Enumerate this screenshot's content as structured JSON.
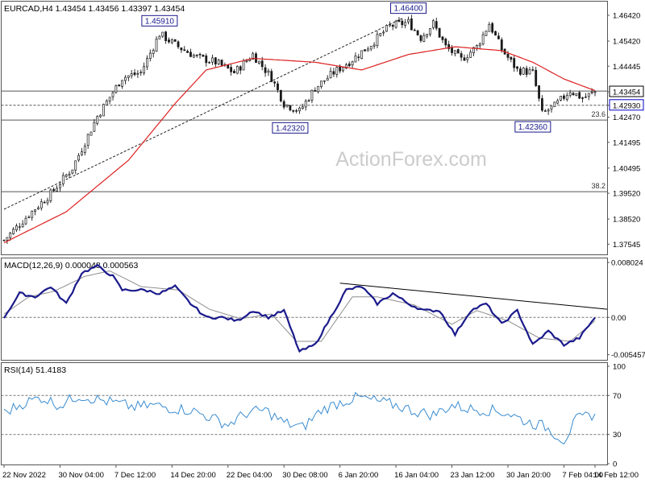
{
  "chart_data": [
    {
      "type": "candlestick",
      "panel": "price",
      "title": "EURCAD,H4  1.43454 1.43456 1.43397 1.43454",
      "watermark": "ActionForex.com",
      "ylim": [
        1.3715,
        1.4695
      ],
      "y_ticks": [
        "1.46420",
        "1.45420",
        "1.44445",
        "1.43454",
        "1.42930",
        "1.42470",
        "1.41495",
        "1.40495",
        "1.39520",
        "1.38520",
        "1.37545"
      ],
      "y_tick_values": [
        1.4642,
        1.4542,
        1.44445,
        1.43454,
        1.4293,
        1.4247,
        1.41495,
        1.40495,
        1.3952,
        1.3852,
        1.37545
      ],
      "last_price": "1.43454",
      "highlight_level": "1.42930",
      "fib_levels": [
        {
          "label": "23.6",
          "value": 1.4236
        },
        {
          "label": "38.2",
          "value": 1.3958
        }
      ],
      "horizontal_lines": [
        1.4348,
        1.4293,
        1.4236,
        1.3958
      ],
      "trend_line": [
        {
          "i": 0,
          "v": 1.389
        },
        {
          "i": 128,
          "v": 1.463
        }
      ],
      "annotations": [
        {
          "text": "1.45910",
          "i": 50,
          "v": 1.4591
        },
        {
          "text": "1.46400",
          "i": 130,
          "v": 1.464
        },
        {
          "text": "1.42320",
          "i": 92,
          "v": 1.4232
        },
        {
          "text": "1.42360",
          "i": 170,
          "v": 1.4236
        }
      ],
      "ma_anchors": [
        [
          0,
          1.376
        ],
        [
          20,
          1.388
        ],
        [
          40,
          1.408
        ],
        [
          55,
          1.43
        ],
        [
          65,
          1.443
        ],
        [
          80,
          1.4475
        ],
        [
          100,
          1.446
        ],
        [
          115,
          1.443
        ],
        [
          130,
          1.449
        ],
        [
          145,
          1.452
        ],
        [
          160,
          1.4505
        ],
        [
          170,
          1.446
        ],
        [
          180,
          1.4395
        ],
        [
          190,
          1.435
        ]
      ],
      "close_anchors": [
        [
          0,
          1.377
        ],
        [
          8,
          1.387
        ],
        [
          15,
          1.395
        ],
        [
          22,
          1.405
        ],
        [
          30,
          1.425
        ],
        [
          38,
          1.44
        ],
        [
          44,
          1.442
        ],
        [
          50,
          1.457
        ],
        [
          56,
          1.452
        ],
        [
          62,
          1.448
        ],
        [
          68,
          1.446
        ],
        [
          74,
          1.442
        ],
        [
          80,
          1.449
        ],
        [
          86,
          1.44
        ],
        [
          90,
          1.43
        ],
        [
          95,
          1.427
        ],
        [
          100,
          1.436
        ],
        [
          106,
          1.442
        ],
        [
          112,
          1.447
        ],
        [
          118,
          1.453
        ],
        [
          124,
          1.46
        ],
        [
          130,
          1.4615
        ],
        [
          134,
          1.4555
        ],
        [
          138,
          1.461
        ],
        [
          142,
          1.452
        ],
        [
          147,
          1.447
        ],
        [
          152,
          1.452
        ],
        [
          156,
          1.461
        ],
        [
          160,
          1.451
        ],
        [
          165,
          1.443
        ],
        [
          170,
          1.442
        ],
        [
          173,
          1.426
        ],
        [
          177,
          1.429
        ],
        [
          182,
          1.435
        ],
        [
          186,
          1.432
        ],
        [
          190,
          1.4345
        ]
      ],
      "candle_count": 191,
      "x_labels": [
        "22 Nov 2022",
        "30 Nov 04:00",
        "7 Dec 12:00",
        "14 Dec 20:00",
        "22 Dec 04:00",
        "30 Dec 08:00",
        "6 Jan 20:00",
        "16 Jan 04:00",
        "23 Jan 12:00",
        "30 Jan 20:00",
        "7 Feb 04:00",
        "14 Feb 12:00"
      ],
      "x_label_index": [
        0,
        18,
        36,
        54,
        72,
        90,
        108,
        126,
        144,
        162,
        180,
        190
      ]
    },
    {
      "type": "line",
      "panel": "macd",
      "title": "MACD(12,26,9) 0.000048 0.000563",
      "ylim": [
        -0.0062,
        0.0085
      ],
      "y_ticks": [
        "0.008024",
        "0.00",
        "-0.005457"
      ],
      "y_tick_values": [
        0.008024,
        0.0,
        -0.005457
      ],
      "trend_line": [
        {
          "i": 108,
          "v": 0.005
        },
        {
          "i": 203,
          "v": 0.0012
        }
      ],
      "macd_anchors": [
        [
          0,
          0.0
        ],
        [
          5,
          0.0035
        ],
        [
          10,
          0.003
        ],
        [
          15,
          0.0045
        ],
        [
          20,
          0.002
        ],
        [
          25,
          0.0065
        ],
        [
          30,
          0.0075
        ],
        [
          35,
          0.006
        ],
        [
          38,
          0.004
        ],
        [
          45,
          0.004
        ],
        [
          50,
          0.0035
        ],
        [
          55,
          0.0045
        ],
        [
          60,
          0.002
        ],
        [
          65,
          0.0
        ],
        [
          70,
          0.0
        ],
        [
          75,
          -0.0005
        ],
        [
          80,
          0.001
        ],
        [
          85,
          0.0
        ],
        [
          90,
          0.001
        ],
        [
          95,
          -0.005
        ],
        [
          100,
          -0.004
        ],
        [
          105,
          0.0
        ],
        [
          110,
          0.004
        ],
        [
          115,
          0.0045
        ],
        [
          120,
          0.002
        ],
        [
          125,
          0.0035
        ],
        [
          130,
          0.002
        ],
        [
          135,
          0.001
        ],
        [
          140,
          0.001
        ],
        [
          145,
          -0.0025
        ],
        [
          150,
          0.001
        ],
        [
          155,
          0.002
        ],
        [
          160,
          -0.001
        ],
        [
          165,
          0.001
        ],
        [
          170,
          -0.004
        ],
        [
          175,
          -0.002
        ],
        [
          180,
          -0.004
        ],
        [
          185,
          -0.003
        ],
        [
          190,
          0.0
        ]
      ],
      "signal_anchors": [
        [
          0,
          0.0005
        ],
        [
          8,
          0.003
        ],
        [
          16,
          0.0038
        ],
        [
          26,
          0.006
        ],
        [
          34,
          0.0068
        ],
        [
          44,
          0.0045
        ],
        [
          56,
          0.004
        ],
        [
          66,
          0.0012
        ],
        [
          76,
          -0.0002
        ],
        [
          86,
          0.0005
        ],
        [
          94,
          -0.0035
        ],
        [
          102,
          -0.0035
        ],
        [
          112,
          0.003
        ],
        [
          120,
          0.003
        ],
        [
          132,
          0.0018
        ],
        [
          144,
          -0.001
        ],
        [
          152,
          0.001
        ],
        [
          162,
          -0.0005
        ],
        [
          172,
          -0.003
        ],
        [
          182,
          -0.0035
        ],
        [
          190,
          -0.0005
        ]
      ]
    },
    {
      "type": "line",
      "panel": "rsi",
      "title": "RSI(14) 51.4183",
      "ylim": [
        0,
        100
      ],
      "y_ticks": [
        "100",
        "70",
        "30",
        "0"
      ],
      "y_tick_values": [
        100,
        70,
        30,
        0
      ],
      "levels": [
        70,
        30
      ],
      "rsi_anchors": [
        [
          0,
          52
        ],
        [
          6,
          62
        ],
        [
          12,
          68
        ],
        [
          18,
          60
        ],
        [
          24,
          70
        ],
        [
          30,
          66
        ],
        [
          36,
          62
        ],
        [
          42,
          58
        ],
        [
          48,
          60
        ],
        [
          54,
          57
        ],
        [
          60,
          55
        ],
        [
          66,
          48
        ],
        [
          72,
          40
        ],
        [
          78,
          52
        ],
        [
          84,
          55
        ],
        [
          90,
          42
        ],
        [
          96,
          37
        ],
        [
          102,
          55
        ],
        [
          108,
          63
        ],
        [
          114,
          68
        ],
        [
          120,
          64
        ],
        [
          126,
          60
        ],
        [
          132,
          54
        ],
        [
          138,
          50
        ],
        [
          144,
          60
        ],
        [
          150,
          56
        ],
        [
          156,
          55
        ],
        [
          162,
          52
        ],
        [
          168,
          43
        ],
        [
          174,
          38
        ],
        [
          180,
          24
        ],
        [
          184,
          45
        ],
        [
          190,
          51.4
        ]
      ]
    }
  ],
  "colors": {
    "candle": "#1a1a1a",
    "ma": "#dd2020",
    "macd_line": "#1a1a8c",
    "signal_line": "#8e8e8e",
    "rsi": "#3a8cd0",
    "grid": "#555555",
    "highlight_box": "#0000cc",
    "watermark": "#cccccc"
  }
}
